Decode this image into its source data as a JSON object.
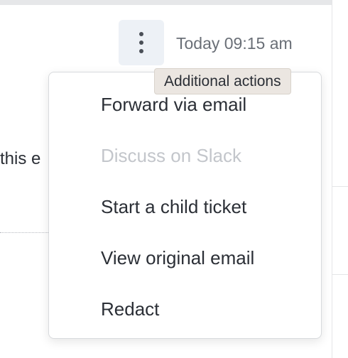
{
  "header": {
    "more_button_icon": "vertical-ellipsis-icon",
    "timestamp": "Today 09:15 am"
  },
  "message": {
    "body_fragment": "this e"
  },
  "tooltip": {
    "text": "Additional actions"
  },
  "menu": {
    "items": [
      {
        "label": "Forward via email",
        "disabled": false
      },
      {
        "label": "Discuss on Slack",
        "disabled": true
      },
      {
        "label": "Start a child ticket",
        "disabled": false
      },
      {
        "label": "View original email",
        "disabled": false
      },
      {
        "label": "Redact",
        "disabled": false
      }
    ]
  },
  "colors": {
    "text": "#2b2f36",
    "muted_text": "#6a6f77",
    "disabled_text": "#c3c6cb",
    "button_bg": "#edf1f6",
    "tooltip_bg": "#ebe6e1"
  }
}
